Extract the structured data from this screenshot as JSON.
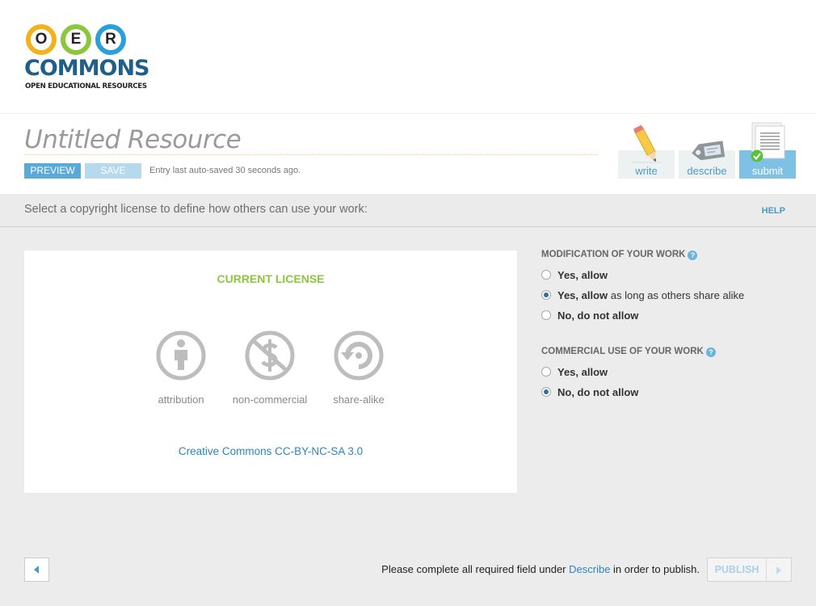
{
  "logo": {
    "letters": [
      "O",
      "E",
      "R"
    ],
    "name": "COMMONS",
    "tagline": "OPEN EDUCATIONAL RESOURCES",
    "colors": [
      "#f2b21d",
      "#8cc63e",
      "#2b9fd8"
    ]
  },
  "editor": {
    "title": "Untitled Resource",
    "preview_label": "PREVIEW",
    "save_label": "SAVE",
    "autosave_text": "Entry last auto-saved 30 seconds ago.",
    "steps": [
      {
        "label": "write",
        "icon": "pencil-icon"
      },
      {
        "label": "describe",
        "icon": "tag-icon"
      },
      {
        "label": "submit",
        "icon": "document-check-icon",
        "active": true
      }
    ]
  },
  "instructions": {
    "text": "Select a copyright license to define how others can use your work:",
    "help_label": "HELP"
  },
  "license": {
    "heading": "CURRENT LICENSE",
    "icons": [
      {
        "label": "attribution",
        "icon": "attribution-icon"
      },
      {
        "label": "non-commercial",
        "icon": "non-commercial-icon"
      },
      {
        "label": "share-alike",
        "icon": "share-alike-icon"
      }
    ],
    "license_name": "Creative Commons CC-BY-NC-SA 3.0"
  },
  "modification": {
    "heading": "MODIFICATION OF YOUR WORK",
    "options": [
      {
        "bold": "Yes, allow",
        "rest": "",
        "selected": false
      },
      {
        "bold": "Yes, allow",
        "rest": " as long as others share alike",
        "selected": true
      },
      {
        "bold": "No, do not allow",
        "rest": "",
        "selected": false
      }
    ]
  },
  "commercial": {
    "heading": "COMMERCIAL USE OF YOUR WORK",
    "options": [
      {
        "bold": "Yes, allow",
        "rest": "",
        "selected": false
      },
      {
        "bold": "No, do not allow",
        "rest": "",
        "selected": true
      }
    ]
  },
  "footer": {
    "msg_before": "Please complete all required field under ",
    "msg_link": "Describe",
    "msg_after": " in order to publish.",
    "publish_label": "PUBLISH"
  },
  "colors": {
    "accent_blue": "#5aaad8",
    "link_blue": "#2b86bb",
    "license_green": "#8cc63e"
  }
}
